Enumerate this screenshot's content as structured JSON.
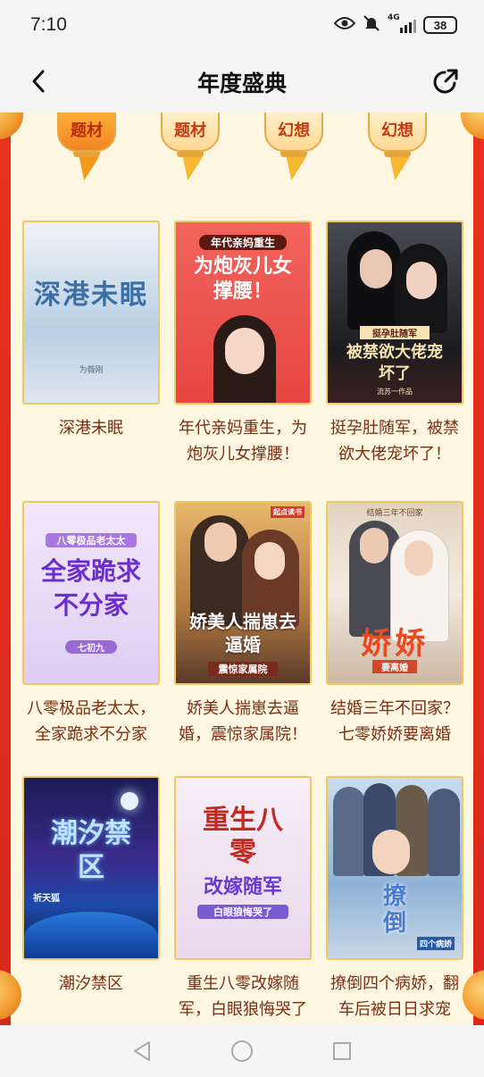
{
  "status": {
    "time": "7:10",
    "network": "4G",
    "battery": "38"
  },
  "nav": {
    "title": "年度盛典"
  },
  "lanterns": [
    {
      "label": "题材",
      "active": true
    },
    {
      "label": "题材",
      "active": false
    },
    {
      "label": "幻想",
      "active": false
    },
    {
      "label": "幻想",
      "active": false
    }
  ],
  "books": [
    {
      "title": "深港未眠",
      "cover_text": "深港未眠",
      "cover_author": "为薇刚",
      "bg": "#dfe9f2",
      "accent": "#4a7fb5"
    },
    {
      "title": "年代亲妈重生，为炮灰儿女撑腰！",
      "cover_banner": "年代亲妈重生",
      "cover_text": "为炮灰儿女撑腰！",
      "bg": "#f0554f",
      "accent": "#ffffff"
    },
    {
      "title": "挺孕肚随军，被禁欲大佬宠坏了！",
      "cover_banner": "挺孕肚随军",
      "cover_text": "被禁欲大佬宠坏了",
      "cover_author": "流苏一作品",
      "bg": "#2a2a2e",
      "accent": "#f6e3b0"
    },
    {
      "title": "八零极品老太太，全家跪求不分家",
      "cover_banner": "八零极品老太太",
      "cover_text": "全家跪求不分家",
      "cover_author": "七初九",
      "bg": "#e7d8f4",
      "accent": "#7b3fd0"
    },
    {
      "title": "娇美人揣崽去逼婚，震惊家属院！",
      "cover_text": "娇美人揣崽去逼婚",
      "cover_sub": "震惊家属院",
      "cover_tag": "起点读书",
      "bg": "#c89a5e",
      "accent": "#ffffff"
    },
    {
      "title": "结婚三年不回家？七零娇娇要离婚",
      "cover_banner": "结婚三年不回家",
      "cover_text": "娇娇",
      "cover_sub": "要离婚",
      "bg": "#d9c7b2",
      "accent": "#e84a24"
    },
    {
      "title": "潮汐禁区",
      "cover_text": "潮汐禁区",
      "cover_author": "祈天狐",
      "bg": "#1a2a6c",
      "accent": "#bfe4ff"
    },
    {
      "title": "重生八零改嫁随军，白眼狼悔哭了",
      "cover_text": "重生八零",
      "cover_sub": "改嫁随军",
      "cover_tag": "白眼狼悔哭了",
      "bg": "#f3e6f3",
      "accent": "#c6281e"
    },
    {
      "title": "撩倒四个病娇，翻车后被日日求宠",
      "cover_text": "撩倒",
      "cover_sub": "四个病娇",
      "bg": "#8fb3d8",
      "accent": "#5b86ce"
    }
  ],
  "colors": {
    "frame": "#e8321f",
    "background": "#fdf6e0",
    "title_text": "#7a2e14",
    "cover_border": "#f0c861"
  },
  "icons": [
    "eye-icon",
    "mute-icon",
    "signal-icon",
    "battery-icon",
    "back-arrow-icon",
    "share-icon",
    "nav-back-icon",
    "nav-home-icon",
    "nav-recents-icon"
  ]
}
